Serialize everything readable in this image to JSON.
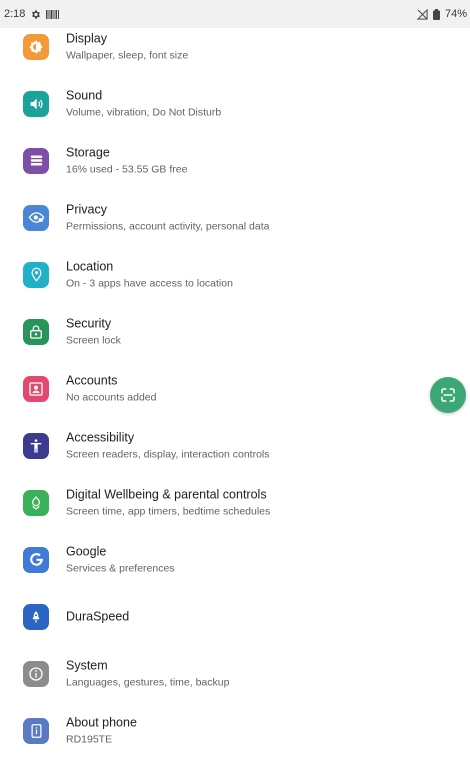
{
  "status_bar": {
    "time": "2:18",
    "battery": "74%",
    "icons": [
      "gear-icon",
      "barcode-icon",
      "signal-off-icon",
      "battery-icon"
    ]
  },
  "settings": [
    {
      "key": "display",
      "title": "Display",
      "subtitle": "Wallpaper, sleep, font size",
      "icon": "display-icon",
      "color": "#f29a37"
    },
    {
      "key": "sound",
      "title": "Sound",
      "subtitle": "Volume, vibration, Do Not Disturb",
      "icon": "speaker-icon",
      "color": "#1aa39a"
    },
    {
      "key": "storage",
      "title": "Storage",
      "subtitle": "16% used - 53.55 GB free",
      "icon": "storage-icon",
      "color": "#7e4fa6"
    },
    {
      "key": "privacy",
      "title": "Privacy",
      "subtitle": "Permissions, account activity, personal data",
      "icon": "eye-lock-icon",
      "color": "#4b86d6"
    },
    {
      "key": "location",
      "title": "Location",
      "subtitle": "On - 3 apps have access to location",
      "icon": "location-pin-icon",
      "color": "#22b0c9"
    },
    {
      "key": "security",
      "title": "Security",
      "subtitle": "Screen lock",
      "icon": "lock-icon",
      "color": "#27955a"
    },
    {
      "key": "accounts",
      "title": "Accounts",
      "subtitle": "No accounts added",
      "icon": "account-card-icon",
      "color": "#e3496f"
    },
    {
      "key": "accessibility",
      "title": "Accessibility",
      "subtitle": "Screen readers, display, interaction controls",
      "icon": "accessibility-icon",
      "color": "#3d3b8f"
    },
    {
      "key": "wellbeing",
      "title": "Digital Wellbeing & parental controls",
      "subtitle": "Screen time, app timers, bedtime schedules",
      "icon": "wellbeing-icon",
      "color": "#3bb05a"
    },
    {
      "key": "google",
      "title": "Google",
      "subtitle": "Services & preferences",
      "icon": "google-icon",
      "color": "#3f7ad6"
    },
    {
      "key": "duraspeed",
      "title": "DuraSpeed",
      "subtitle": "",
      "icon": "rocket-icon",
      "color": "#2d66c2"
    },
    {
      "key": "system",
      "title": "System",
      "subtitle": "Languages, gestures, time, backup",
      "icon": "info-icon",
      "color": "#8c8c8c"
    },
    {
      "key": "about",
      "title": "About phone",
      "subtitle": "RD195TE",
      "icon": "phone-info-icon",
      "color": "#5a7ac4"
    }
  ],
  "fab": {
    "icon": "scan-icon",
    "color": "#3ea777"
  }
}
